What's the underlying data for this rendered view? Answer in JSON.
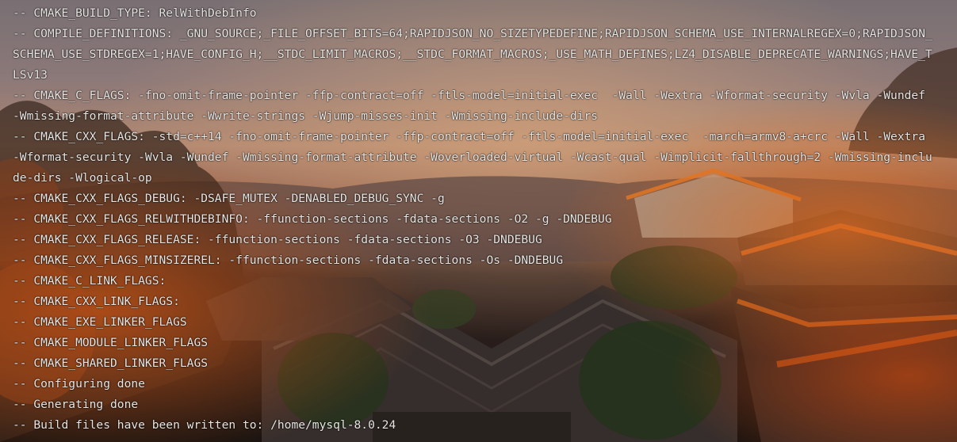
{
  "terminal": {
    "background": "sunset-town-rooftops-image",
    "text_color": "#e9e7e4",
    "lines": [
      "-- CMAKE_BUILD_TYPE: RelWithDebInfo",
      "-- COMPILE_DEFINITIONS: _GNU_SOURCE;_FILE_OFFSET_BITS=64;RAPIDJSON_NO_SIZETYPEDEFINE;RAPIDJSON_SCHEMA_USE_INTERNALREGEX=0;RAPIDJSON_",
      "SCHEMA_USE_STDREGEX=1;HAVE_CONFIG_H;__STDC_LIMIT_MACROS;__STDC_FORMAT_MACROS;_USE_MATH_DEFINES;LZ4_DISABLE_DEPRECATE_WARNINGS;HAVE_T",
      "LSv13",
      "-- CMAKE_C_FLAGS: -fno-omit-frame-pointer -ffp-contract=off -ftls-model=initial-exec  -Wall -Wextra -Wformat-security -Wvla -Wundef",
      "-Wmissing-format-attribute -Wwrite-strings -Wjump-misses-init -Wmissing-include-dirs",
      "-- CMAKE_CXX_FLAGS: -std=c++14 -fno-omit-frame-pointer -ffp-contract=off -ftls-model=initial-exec  -march=armv8-a+crc -Wall -Wextra",
      "-Wformat-security -Wvla -Wundef -Wmissing-format-attribute -Woverloaded-virtual -Wcast-qual -Wimplicit-fallthrough=2 -Wmissing-inclu",
      "de-dirs -Wlogical-op",
      "-- CMAKE_CXX_FLAGS_DEBUG: -DSAFE_MUTEX -DENABLED_DEBUG_SYNC -g",
      "-- CMAKE_CXX_FLAGS_RELWITHDEBINFO: -ffunction-sections -fdata-sections -O2 -g -DNDEBUG",
      "-- CMAKE_CXX_FLAGS_RELEASE: -ffunction-sections -fdata-sections -O3 -DNDEBUG",
      "-- CMAKE_CXX_FLAGS_MINSIZEREL: -ffunction-sections -fdata-sections -Os -DNDEBUG",
      "-- CMAKE_C_LINK_FLAGS:",
      "-- CMAKE_CXX_LINK_FLAGS:",
      "-- CMAKE_EXE_LINKER_FLAGS",
      "-- CMAKE_MODULE_LINKER_FLAGS",
      "-- CMAKE_SHARED_LINKER_FLAGS",
      "-- Configuring done",
      "-- Generating done",
      "-- Build files have been written to: /home/mysql-8.0.24"
    ]
  }
}
